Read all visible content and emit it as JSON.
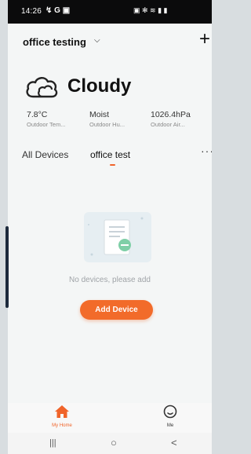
{
  "status_bar": {
    "time": "14:26",
    "left_icons_text": "↯ G ▣",
    "right_icons_text": "▣ ✻ ≋ ▮ ▮"
  },
  "header": {
    "home_name": "office testing",
    "chevron_icon": "chevron-down-icon",
    "add_icon": "plus-icon"
  },
  "weather": {
    "condition": "Cloudy",
    "icon": "cloud-icon",
    "stats": [
      {
        "value": "7.8°C",
        "label": "Outdoor Tem..."
      },
      {
        "value": "Moist",
        "label": "Outdoor Hu..."
      },
      {
        "value": "1026.4hPa",
        "label": "Outdoor Air..."
      }
    ]
  },
  "tabs": {
    "items": [
      {
        "label": "All Devices"
      },
      {
        "label": "office test"
      }
    ],
    "active_index": 1,
    "more_label": "···"
  },
  "empty_state": {
    "message": "No devices, please add",
    "button_label": "Add Device"
  },
  "bottom_nav": {
    "items": [
      {
        "label": "My Home",
        "icon": "home-icon",
        "active": true
      },
      {
        "label": "Me",
        "icon": "smiley-icon",
        "active": false
      }
    ]
  },
  "system_nav": {
    "recent": "|||",
    "home": "○",
    "back": "<"
  },
  "colors": {
    "accent": "#f26b2a",
    "background": "#f4f6f6",
    "status_bar": "#0b0b0c"
  }
}
